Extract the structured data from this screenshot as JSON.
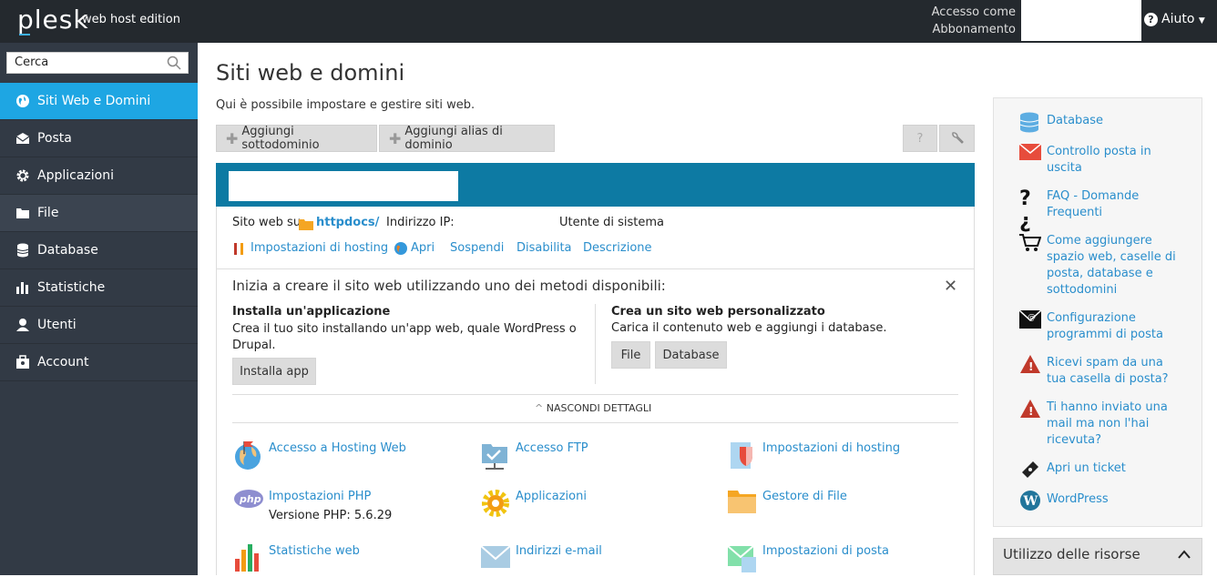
{
  "header": {
    "logo": "plesk",
    "edition": "web host edition",
    "access_line1": "Accesso come",
    "access_line2": "Abbonamento",
    "help_label": "Aiuto"
  },
  "sidebar": {
    "search_placeholder": "Cerca",
    "items": [
      {
        "label": "Siti Web e Domini",
        "icon": "globe-icon"
      },
      {
        "label": "Posta",
        "icon": "envelope-icon"
      },
      {
        "label": "Applicazioni",
        "icon": "gear-icon"
      },
      {
        "label": "File",
        "icon": "folder-icon"
      },
      {
        "label": "Database",
        "icon": "database-icon"
      },
      {
        "label": "Statistiche",
        "icon": "bar-chart-icon"
      },
      {
        "label": "Utenti",
        "icon": "user-icon"
      },
      {
        "label": "Account",
        "icon": "account-icon"
      }
    ]
  },
  "page": {
    "title": "Siti web e domini",
    "subtitle": "Qui è possibile impostare e gestire siti web.",
    "add_subdomain": "Aggiungi sottodominio",
    "add_alias": "Aggiungi alias di dominio"
  },
  "domain": {
    "website_at": "Sito web su",
    "docroot": "httpdocs/",
    "ip_label": "Indirizzo IP:",
    "sysuser_label": "Utente di sistema",
    "actions": [
      "Impostazioni di hosting",
      "Apri",
      "Sospendi",
      "Disabilita",
      "Descrizione"
    ]
  },
  "getting_started": {
    "heading": "Inizia a creare il sito web utilizzando uno dei metodi disponibili:",
    "install_title": "Installa un'applicazione",
    "install_desc": "Crea il tuo sito installando un'app web, quale WordPress o Drupal.",
    "install_button": "Installa app",
    "custom_title": "Crea un sito web personalizzato",
    "custom_desc": "Carica il contenuto web e aggiungi i database.",
    "file_button": "File",
    "database_button": "Database",
    "hide_details": "NASCONDI DETTAGLI"
  },
  "tools": [
    {
      "label": "Accesso a Hosting Web",
      "icon": "globe-flag-icon"
    },
    {
      "label": "Accesso FTP",
      "icon": "ftp-folder-icon"
    },
    {
      "label": "Impostazioni di hosting",
      "icon": "hosting-settings-icon"
    },
    {
      "label": "Impostazioni PHP",
      "icon": "php-icon",
      "sub": "Versione PHP: 5.6.29"
    },
    {
      "label": "Applicazioni",
      "icon": "gear-icon"
    },
    {
      "label": "Gestore di File",
      "icon": "folder-icon"
    },
    {
      "label": "Statistiche web",
      "icon": "bar-chart-icon"
    },
    {
      "label": "Indirizzi e-mail",
      "icon": "envelope-icon"
    },
    {
      "label": "Impostazioni di posta",
      "icon": "mail-settings-icon"
    }
  ],
  "right_panel": {
    "links": [
      {
        "label": "Database",
        "icon": "database-icon"
      },
      {
        "label": "Controllo posta in uscita",
        "icon": "envelope-icon"
      },
      {
        "label": "FAQ - Domande Frequenti",
        "icon": "question-icon"
      },
      {
        "label": "Come aggiungere spazio web, caselle di posta, database e sottodomini",
        "icon": "cart-icon"
      },
      {
        "label": "Configurazione programmi di posta",
        "icon": "mail-config-icon"
      },
      {
        "label": "Ricevi spam da una tua casella di posta?",
        "icon": "warning-icon"
      },
      {
        "label": "Ti hanno inviato una mail ma non l'hai ricevuta?",
        "icon": "warning-icon"
      },
      {
        "label": "Apri un ticket",
        "icon": "ticket-icon"
      },
      {
        "label": "WordPress",
        "icon": "wordpress-icon"
      }
    ],
    "resources_title": "Utilizzo delle risorse"
  }
}
